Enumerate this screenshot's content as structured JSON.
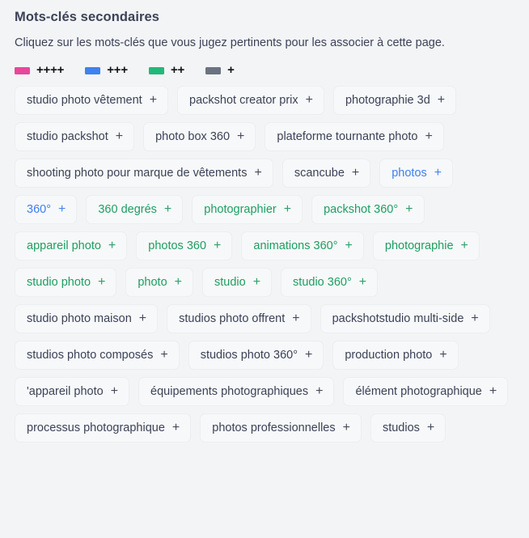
{
  "panel": {
    "title": "Mots-clés secondaires",
    "subtitle": "Cliquez sur les mots-clés que vous jugez pertinents pour les associer à cette page."
  },
  "legend": {
    "items": [
      {
        "label": "++++",
        "color": "#e8479b",
        "level": 4
      },
      {
        "label": "+++",
        "color": "#3d82f0",
        "level": 3
      },
      {
        "label": "++",
        "color": "#21b97a",
        "level": 2
      },
      {
        "label": "+",
        "color": "#6b7280",
        "level": 1
      }
    ]
  },
  "tags": {
    "plus_glyph": "+",
    "items": [
      {
        "label": "studio photo vêtement",
        "level": 1
      },
      {
        "label": "packshot creator prix",
        "level": 1
      },
      {
        "label": "photographie 3d",
        "level": 1
      },
      {
        "label": "studio packshot",
        "level": 1
      },
      {
        "label": "photo box 360",
        "level": 1
      },
      {
        "label": "plateforme tournante photo",
        "level": 1
      },
      {
        "label": "shooting photo pour marque de vêtements",
        "level": 1
      },
      {
        "label": "scancube",
        "level": 1
      },
      {
        "label": "photos",
        "level": 3
      },
      {
        "label": "360°",
        "level": 3
      },
      {
        "label": "360 degrés",
        "level": 2
      },
      {
        "label": "photographier",
        "level": 2
      },
      {
        "label": "packshot 360°",
        "level": 2
      },
      {
        "label": "appareil photo",
        "level": 2
      },
      {
        "label": "photos 360",
        "level": 2
      },
      {
        "label": "animations 360°",
        "level": 2
      },
      {
        "label": "photographie",
        "level": 2
      },
      {
        "label": "studio photo",
        "level": 2
      },
      {
        "label": "photo",
        "level": 2
      },
      {
        "label": "studio",
        "level": 2
      },
      {
        "label": "studio 360°",
        "level": 2
      },
      {
        "label": "studio photo maison",
        "level": 1
      },
      {
        "label": "studios photo offrent",
        "level": 1
      },
      {
        "label": "packshotstudio multi-side",
        "level": 1
      },
      {
        "label": "studios photo composés",
        "level": 1
      },
      {
        "label": "studios photo 360°",
        "level": 1
      },
      {
        "label": "production photo",
        "level": 1
      },
      {
        "label": "'appareil photo",
        "level": 1
      },
      {
        "label": "équipements photographiques",
        "level": 1
      },
      {
        "label": "élément photographique",
        "level": 1
      },
      {
        "label": "processus photographique",
        "level": 1
      },
      {
        "label": "photos professionnelles",
        "level": 1
      },
      {
        "label": "studios",
        "level": 1
      }
    ]
  }
}
